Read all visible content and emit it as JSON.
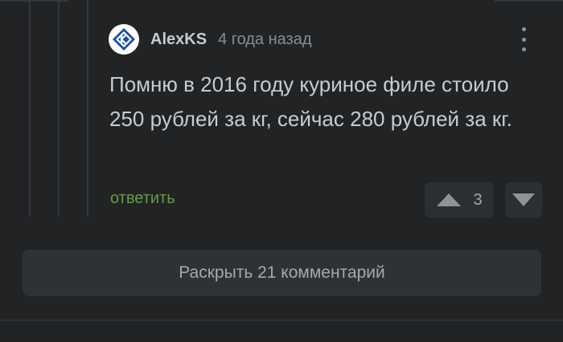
{
  "comment": {
    "avatar_icon": "kvadrat-logo-icon",
    "username": "AlexKS",
    "timestamp": "4 года назад",
    "text": "Помню в 2016 году куриное филе стоило 250 рублей за кг, сейчас 280 рублей за кг.",
    "reply_label": "ответить",
    "score": "3",
    "more_icon": "more-vertical-icon",
    "upvote_icon": "triangle-up-icon",
    "downvote_icon": "triangle-down-icon"
  },
  "expand": {
    "label": "Раскрыть 21 комментарий"
  },
  "colors": {
    "background": "#212325",
    "text": "#c9ccce",
    "muted": "#898d90",
    "reply": "#6b9a4a",
    "button_bg": "#2f3234",
    "avatar_blue": "#1f4fa0"
  }
}
